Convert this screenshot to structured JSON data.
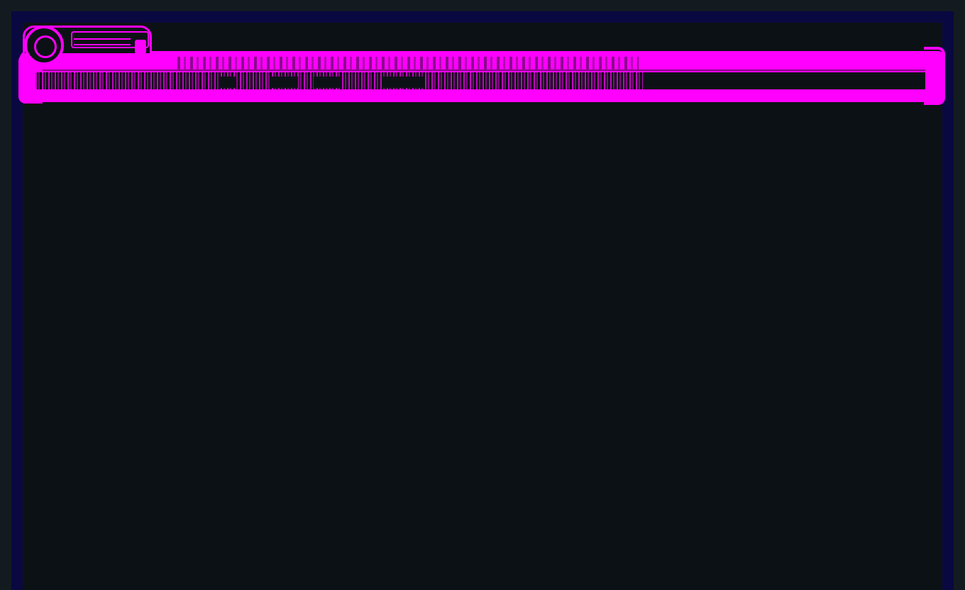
{
  "app": {
    "name": "",
    "status": ""
  },
  "colors": {
    "background": "#131b21",
    "frame": "#0a0840",
    "viewport": "#0c1115",
    "accent": "#ff00ff"
  },
  "hud": {
    "tab_icon": "ring-icon",
    "handle_icon": "handle-icon",
    "header_text": "",
    "progress_text": ""
  }
}
